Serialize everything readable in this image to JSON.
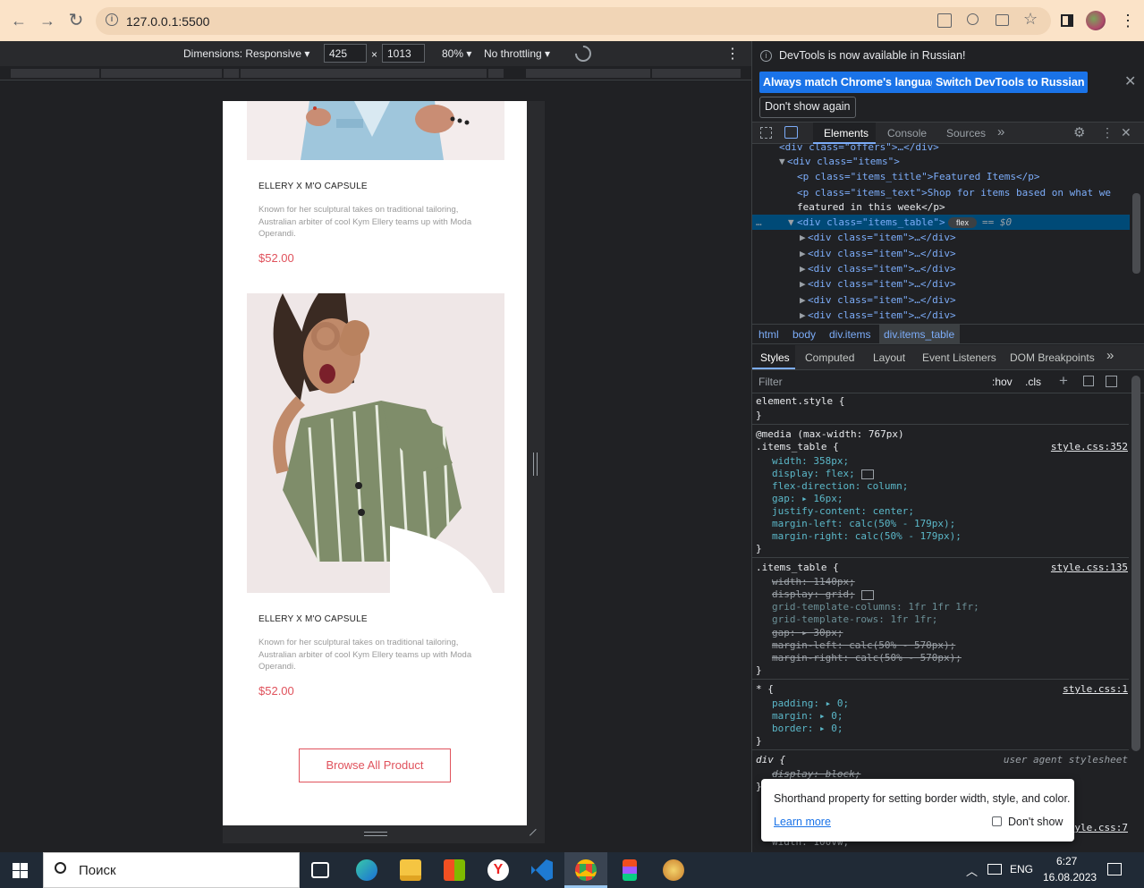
{
  "browser": {
    "url": "127.0.0.1:5500",
    "back_icon": "←",
    "forward_icon": "→",
    "reload_icon": "↻"
  },
  "device_toolbar": {
    "dimensions_label": "Dimensions: Responsive ▾",
    "width": "425",
    "times": "×",
    "height": "1013",
    "zoom": "80% ▾",
    "throttling": "No throttling ▾"
  },
  "page": {
    "products": [
      {
        "title": "ELLERY X M'O CAPSULE",
        "description": "Known for her sculptural takes on traditional tailoring, Australian arbiter of cool Kym Ellery teams up with Moda Operandi.",
        "price": "$52.00"
      },
      {
        "title": "ELLERY X M'O CAPSULE",
        "description": "Known for her sculptural takes on traditional tailoring, Australian arbiter of cool Kym Ellery teams up with Moda Operandi.",
        "price": "$52.00"
      }
    ],
    "browse_button": "Browse All Product"
  },
  "devtools": {
    "info_message": "DevTools is now available in Russian!",
    "match_language_button": "Always match Chrome's language",
    "switch_button": "Switch DevTools to Russian",
    "dont_show_again": "Don't show again",
    "tabs": [
      "Elements",
      "Console",
      "Sources"
    ],
    "breadcrumbs": [
      "html",
      "body",
      "div.items",
      "div.items_table"
    ],
    "style_tabs": [
      "Styles",
      "Computed",
      "Layout",
      "Event Listeners",
      "DOM Breakpoints"
    ],
    "filter_placeholder": "Filter",
    "hov": ":hov",
    "cls": ".cls",
    "dom": {
      "line0": "<div class=\"offers\">…</div>",
      "line1_tag": "<div class=\"items\">",
      "line2": "<p class=\"items_title\">Featured Items</p>",
      "line3a": "<p class=\"items_text\">Shop for items based on what we",
      "line3b": "featured in this week</p>",
      "selected": "<div class=\"items_table\">",
      "flex_badge": "flex",
      "selected_suffix": "== $0",
      "item_line": "<div class=\"item\">…</div>"
    },
    "styles": {
      "element_style": "element.style {",
      "close": "}",
      "media": "@media (max-width: 767px)",
      "rule1_selector": ".items_table {",
      "rule1_src": "style.css:352",
      "rule1_props": [
        "width: 358px;",
        "display: flex;",
        "flex-direction: column;",
        "gap: ▸ 16px;",
        "justify-content: center;",
        "margin-left: calc(50% - 179px);",
        "margin-right: calc(50% - 179px);"
      ],
      "rule2_selector": ".items_table {",
      "rule2_src": "style.css:135",
      "rule2_props": [
        "width: 1140px;",
        "display: grid;",
        "grid-template-columns: 1fr 1fr 1fr;",
        "grid-template-rows: 1fr 1fr;",
        "gap: ▸ 30px;",
        "margin-left: calc(50% - 570px);",
        "margin-right: calc(50% - 570px);"
      ],
      "rule3_selector": "* {",
      "rule3_src": "style.css:1",
      "rule3_props": [
        "padding: ▸ 0;",
        "margin: ▸ 0;",
        "border: ▸ 0;"
      ],
      "rule4_selector": "div {",
      "rule4_src": "user agent stylesheet",
      "rule4_props": [
        "display: block;"
      ],
      "rule5_src": "style.css:7",
      "rule5_partial": "width: 100vw;"
    },
    "tooltip": {
      "text": "Shorthand property for setting border width, style, and color.",
      "learn_more": "Learn more",
      "dont_show": "Don't show"
    }
  },
  "taskbar": {
    "search_placeholder": "Поиск",
    "language": "ENG",
    "time": "6:27",
    "date": "16.08.2023"
  }
}
